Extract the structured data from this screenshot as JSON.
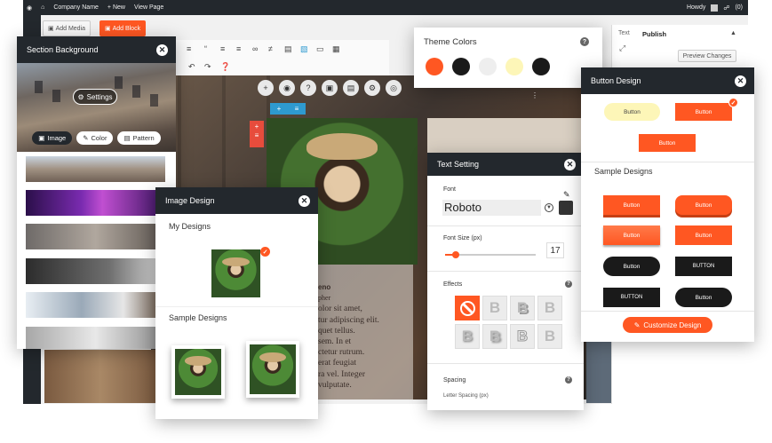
{
  "wp": {
    "site_name": "Company Name",
    "admin_new": "+ New",
    "admin_view": "View Page",
    "admin_howdy": "Howdy",
    "admin_count": "(0)",
    "add_media": "Add Media",
    "add_block": "Add Block",
    "text_tab": "Text",
    "publish": "Publish",
    "preview_changes": "Preview Changes",
    "lorem_heading": "eno",
    "lorem_sub": "pher",
    "lorem_lines": [
      "olor sit amet,",
      "tur adipiscing elit.",
      "quet tellus.",
      "sem. In et",
      "ctetur rutrum.",
      "erat feugiat",
      "ra vel. Integer",
      "vulputate."
    ]
  },
  "section_background": {
    "title": "Section Background",
    "settings_label": "Settings",
    "tabs": [
      {
        "label": "Image",
        "active": true
      },
      {
        "label": "Color",
        "active": false
      },
      {
        "label": "Pattern",
        "active": false
      }
    ]
  },
  "image_design": {
    "title": "Image Design",
    "my_designs": "My Designs",
    "sample_designs": "Sample Designs"
  },
  "theme_colors": {
    "title": "Theme Colors",
    "swatches": [
      "#ff5722",
      "#1a1a1a",
      "#eeeeee",
      "#fdf6b8",
      "#1a1a1a"
    ]
  },
  "text_setting": {
    "title": "Text Setting",
    "font_label": "Font",
    "font_value": "Roboto",
    "font_size_label": "Font Size (px)",
    "font_size_value": "17",
    "font_size_fraction": 0.12,
    "effects_label": "Effects",
    "spacing_label": "Spacing",
    "letter_spacing_label": "Letter Spacing (px)",
    "effect_letter": "B"
  },
  "button_design": {
    "title": "Button Design",
    "button_label": "Button",
    "button_label_caps": "BUTTON",
    "sample_designs": "Sample Designs",
    "customize_label": "Customize Design"
  },
  "colors": {
    "accent": "#ff5722",
    "dark": "#23282d"
  }
}
